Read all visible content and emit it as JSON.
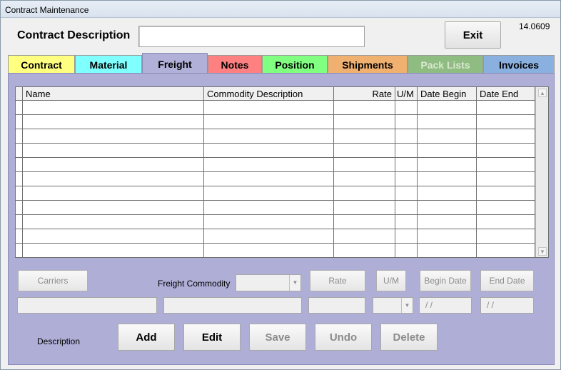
{
  "window": {
    "title": "Contract Maintenance"
  },
  "header": {
    "contract_description_label": "Contract Description",
    "contract_description_value": "",
    "exit_label": "Exit",
    "version": "14.0609"
  },
  "tabs": [
    {
      "label": "Contract",
      "color": "#ffff80",
      "active": false,
      "enabled": true
    },
    {
      "label": "Material",
      "color": "#80ffff",
      "active": false,
      "enabled": true
    },
    {
      "label": "Freight",
      "color": "#b0b0d8",
      "active": true,
      "enabled": true
    },
    {
      "label": "Notes",
      "color": "#ff8080",
      "active": false,
      "enabled": true
    },
    {
      "label": "Position",
      "color": "#80ff80",
      "active": false,
      "enabled": true
    },
    {
      "label": "Shipments",
      "color": "#f0b070",
      "active": false,
      "enabled": true
    },
    {
      "label": "Pack Lists",
      "color": "#8fbc80",
      "active": false,
      "enabled": false
    },
    {
      "label": "Invoices",
      "color": "#8ab0e0",
      "active": false,
      "enabled": true
    }
  ],
  "grid": {
    "columns": [
      "Name",
      "Commodity Description",
      "Rate",
      "U/M",
      "Date Begin",
      "Date End"
    ],
    "rows": [
      [
        "",
        "",
        "",
        "",
        "",
        ""
      ],
      [
        "",
        "",
        "",
        "",
        "",
        ""
      ],
      [
        "",
        "",
        "",
        "",
        "",
        ""
      ],
      [
        "",
        "",
        "",
        "",
        "",
        ""
      ],
      [
        "",
        "",
        "",
        "",
        "",
        ""
      ],
      [
        "",
        "",
        "",
        "",
        "",
        ""
      ],
      [
        "",
        "",
        "",
        "",
        "",
        ""
      ],
      [
        "",
        "",
        "",
        "",
        "",
        ""
      ],
      [
        "",
        "",
        "",
        "",
        "",
        ""
      ],
      [
        "",
        "",
        "",
        "",
        "",
        ""
      ],
      [
        "",
        "",
        "",
        "",
        "",
        ""
      ]
    ]
  },
  "form": {
    "carriers_label": "Carriers",
    "freight_commodity_label": "Freight Commodity",
    "freight_commodity_value": "",
    "rate_label": "Rate",
    "um_label": "U/M",
    "begin_date_label": "Begin Date",
    "end_date_label": "End Date",
    "carrier_name_value": "",
    "commodity_desc_value": "",
    "rate_value": "",
    "um_value": "",
    "begin_date_value": "/ /",
    "end_date_value": "/ /",
    "description_label": "Description"
  },
  "actions": {
    "add": "Add",
    "edit": "Edit",
    "save": "Save",
    "undo": "Undo",
    "delete": "Delete"
  }
}
